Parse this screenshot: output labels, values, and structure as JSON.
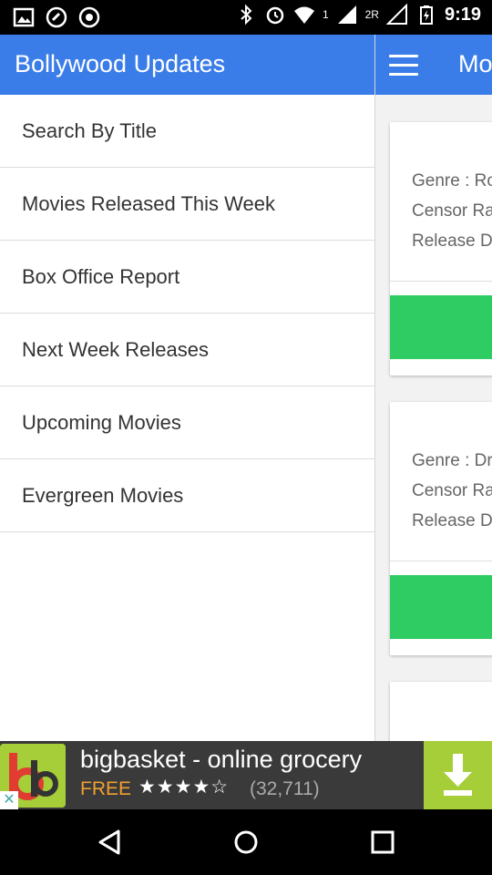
{
  "status_bar": {
    "time": "9:19",
    "sim1_label": "1",
    "sim2_label": "2R",
    "icons": [
      "gallery-icon",
      "phone-app-icon",
      "chrome-icon",
      "bluetooth-icon",
      "alarm-icon",
      "wifi-icon",
      "signal-icon",
      "battery-charging-icon"
    ]
  },
  "main": {
    "title": "Mo",
    "cards": [
      {
        "genre": "Genre : Ro",
        "censor": "Censor Ra",
        "release": "Release D"
      },
      {
        "genre": "Genre : Dr",
        "censor": "Censor Ra",
        "release": "Release D"
      },
      {
        "genre": "",
        "censor": "",
        "release": ""
      }
    ],
    "button_color": "#2ecc62"
  },
  "drawer": {
    "title": "Bollywood Updates",
    "items": [
      {
        "label": "Search By Title"
      },
      {
        "label": "Movies Released This Week"
      },
      {
        "label": "Box Office Report"
      },
      {
        "label": "Next Week Releases"
      },
      {
        "label": "Upcoming Movies"
      },
      {
        "label": "Evergreen Movies"
      }
    ]
  },
  "ad": {
    "title": "bigbasket - online grocery",
    "price": "FREE",
    "stars": "★★★★☆",
    "rating_count": "(32,711)",
    "close_glyph": "✕"
  },
  "colors": {
    "app_bar": "#3b7de8",
    "ad_accent": "#a6ce39"
  }
}
